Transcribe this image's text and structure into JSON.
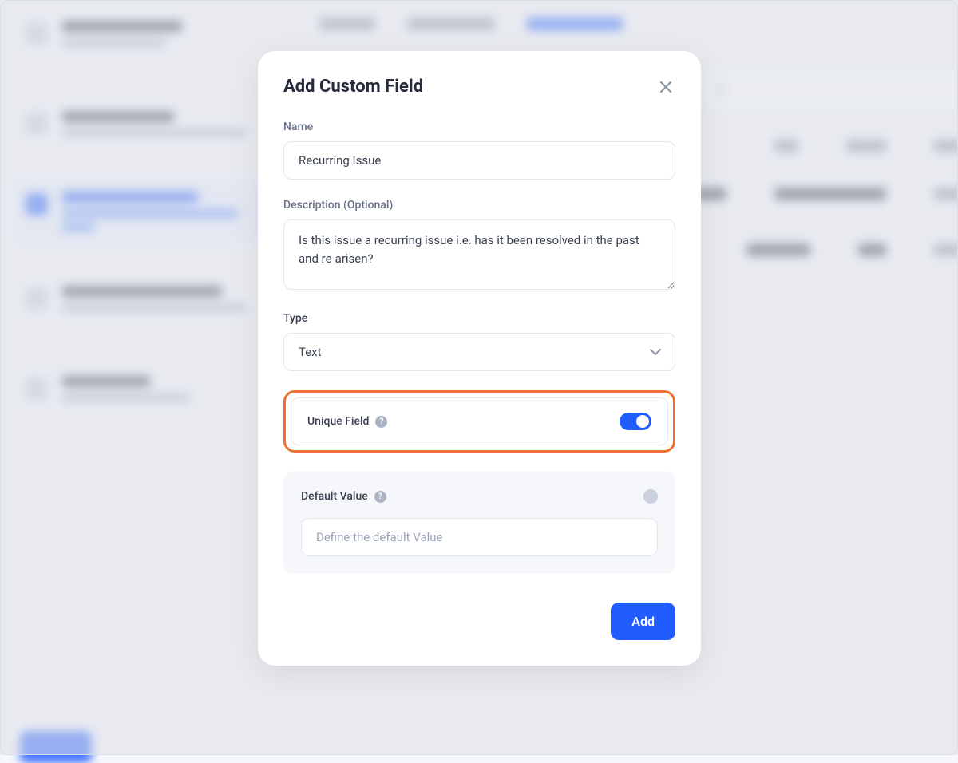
{
  "background": {
    "sidebar": {
      "items": [
        {
          "title": "Account Settings",
          "subtitle": "Update profile account",
          "active": false,
          "sub2": ""
        },
        {
          "title": "User Management",
          "subtitle": "Add, edit, and view all users and their login",
          "active": false,
          "sub2": ""
        },
        {
          "title": "Entity Management",
          "subtitle": "Easily edit or remove any category from your data.",
          "active": true,
          "sub2": ""
        },
        {
          "title": "Default Display Settings",
          "subtitle": "Define how your table will be displayed",
          "active": false,
          "sub2": ""
        },
        {
          "title": "Notifications",
          "subtitle": "Manage notifications",
          "active": false,
          "sub2": ""
        }
      ]
    },
    "tabs": [
      {
        "label": "Policies",
        "active": false
      },
      {
        "label": "Default Fields",
        "active": false
      },
      {
        "label": "Custom Fields",
        "active": true
      }
    ],
    "search_placeholder": "Search"
  },
  "modal": {
    "title": "Add Custom Field",
    "name": {
      "label": "Name",
      "value": "Recurring Issue"
    },
    "description": {
      "label": "Description (Optional)",
      "value": "Is this issue a recurring issue i.e. has it been resolved in the past and re-arisen?"
    },
    "type": {
      "label": "Type",
      "value": "Text"
    },
    "unique": {
      "label": "Unique Field",
      "enabled": true
    },
    "default_value": {
      "label": "Default Value",
      "placeholder": "Define the default Value",
      "enabled": false
    },
    "submit_label": "Add"
  },
  "colors": {
    "accent": "#215cff",
    "highlight": "#e8722f"
  }
}
